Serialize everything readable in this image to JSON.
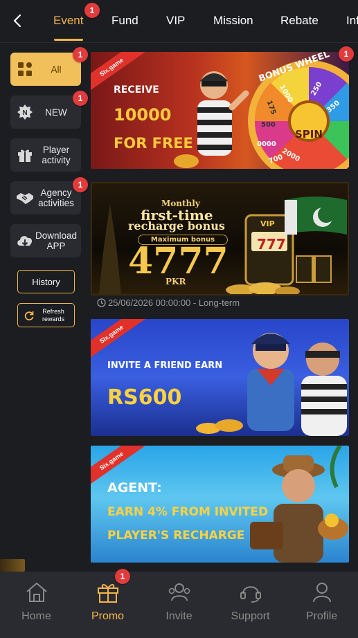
{
  "tabs": [
    {
      "label": "Event",
      "badge": "1",
      "active": true
    },
    {
      "label": "Fund"
    },
    {
      "label": "VIP"
    },
    {
      "label": "Mission"
    },
    {
      "label": "Rebate"
    },
    {
      "label": "Inf"
    }
  ],
  "sidebar": {
    "items": [
      {
        "label": "All",
        "badge": "1",
        "icon": "grid-icon",
        "active": true
      },
      {
        "label": "NEW",
        "badge": "1",
        "icon": "new-icon"
      },
      {
        "label": "Player activity",
        "icon": "gift-icon"
      },
      {
        "label": "Agency activities",
        "badge": "1",
        "icon": "handshake-icon"
      },
      {
        "label": "Download APP",
        "icon": "download-icon"
      }
    ],
    "history_label": "History",
    "refresh_label": "Refresh rewards"
  },
  "banners": [
    {
      "brand": "Six.game",
      "line1": "RECEIVE",
      "line2": "10000",
      "line3": "FOR FREE",
      "wheel_label": "BONUS WHEEL",
      "spin": "SPIN",
      "badge": "1",
      "wheel_numbers": [
        "1000",
        "250",
        "350",
        "500",
        "0000",
        "2000",
        "700",
        "175"
      ]
    },
    {
      "line1": "Monthly",
      "line2": "first-time",
      "line3": "recharge bonus",
      "sub": "Maximum bonus",
      "amount": "4777",
      "currency": "PKR",
      "vip": "VIP",
      "slot": "777",
      "date": "25/06/2026 00:00:00 - Long-term"
    },
    {
      "brand": "Six.game",
      "line1": "INVITE A FRIEND EARN",
      "line2": "RS600"
    },
    {
      "brand": "Six.game",
      "line1": "AGENT:",
      "line2": "EARN 4% FROM INVITED",
      "line3": "PLAYER'S RECHARGE"
    }
  ],
  "nav": [
    {
      "label": "Home",
      "icon": "home-icon"
    },
    {
      "label": "Promo",
      "icon": "gift-icon",
      "badge": "1",
      "active": true
    },
    {
      "label": "Invite",
      "icon": "invite-icon"
    },
    {
      "label": "Support",
      "icon": "headset-icon"
    },
    {
      "label": "Profile",
      "icon": "profile-icon"
    }
  ],
  "colors": {
    "accent": "#f2b64a",
    "badge": "#e23b3b",
    "background": "#1c1d21",
    "panel": "#2a2b30"
  }
}
